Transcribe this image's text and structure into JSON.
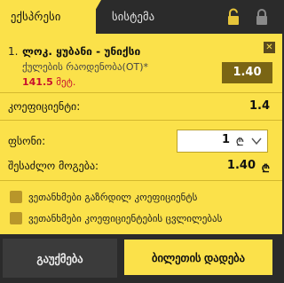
{
  "tabs": {
    "express": "ექსპრესი",
    "system": "სისტემა"
  },
  "bet": {
    "index": "1.",
    "title": "ლოკ. ყუბანი - უნიქსი",
    "market": "ქულების რაოდენობა(OT)*",
    "line_value": "141.5",
    "line_unit": "მეტ.",
    "odds": "1.40"
  },
  "coefficient": {
    "label": "კოეფიციენტი:",
    "value": "1.4"
  },
  "stake": {
    "label": "ფსონი:",
    "value": "1",
    "currency_icon": "lari-icon"
  },
  "payout": {
    "label": "შესაძლო მოგება:",
    "value": "1.40"
  },
  "options": [
    {
      "label": "ვეთანხმები გაზრდილ კოეფიციენტს"
    },
    {
      "label": "ვეთანხმები კოეფიციენტების ცვლილებას"
    }
  ],
  "buttons": {
    "cancel": "გაუქმება",
    "place": "ბილეთის დადება"
  },
  "colors": {
    "accent": "#fbe14a",
    "dark": "#2b2b2b",
    "odds_bg": "#7a6514",
    "highlight": "#c8102e"
  }
}
